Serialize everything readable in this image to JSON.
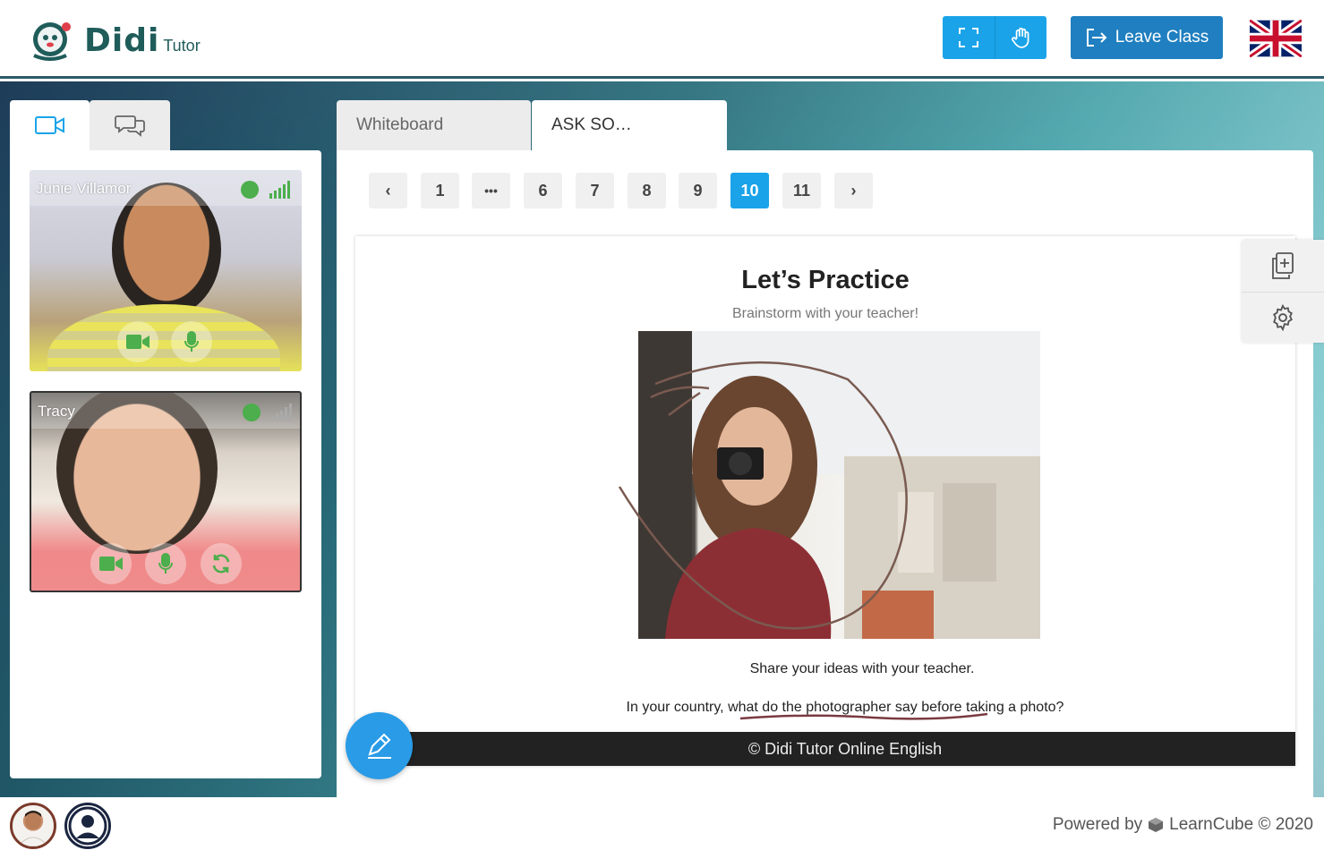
{
  "header": {
    "logo_text": "Didi",
    "logo_sub": "Tutor",
    "fullscreen_icon": "fullscreen-icon",
    "hand_icon": "raise-hand-icon",
    "leave_label": "Leave Class",
    "language_flag": "uk-flag",
    "accent": "#1aa3e8",
    "leave_color": "#1f7fc0"
  },
  "left_panel": {
    "tabs": [
      {
        "icon": "video-camera-icon",
        "active": true
      },
      {
        "icon": "chat-icon",
        "active": false
      }
    ],
    "participants": [
      {
        "name": "Junie Villamor",
        "status_color": "#4cae4c",
        "controls": [
          "camera-icon",
          "microphone-icon"
        ]
      },
      {
        "name": "Tracy",
        "status_color": "#4cae4c",
        "controls": [
          "camera-icon",
          "microphone-icon",
          "refresh-icon"
        ]
      }
    ]
  },
  "main": {
    "tabs": [
      {
        "label": "Whiteboard",
        "active": false
      },
      {
        "label": "ASK SO…",
        "active": true
      }
    ],
    "pagination": {
      "prev": "‹",
      "items": [
        "1",
        "•••",
        "6",
        "7",
        "8",
        "9",
        "10",
        "11"
      ],
      "active": "10",
      "next": "›"
    },
    "slide": {
      "title": "Let’s Practice",
      "subtitle": "Brainstorm with your teacher!",
      "text1": "Share your ideas with your teacher.",
      "text2": "In your country, what do the photographer say before taking a photo?",
      "footer": "© Didi Tutor Online English"
    },
    "side_tools": [
      "add-page-icon",
      "settings-gear-icon"
    ],
    "pen_tool": "pen-icon"
  },
  "footer": {
    "powered_by": "Powered by",
    "brand": "LearnCube © 2020"
  }
}
